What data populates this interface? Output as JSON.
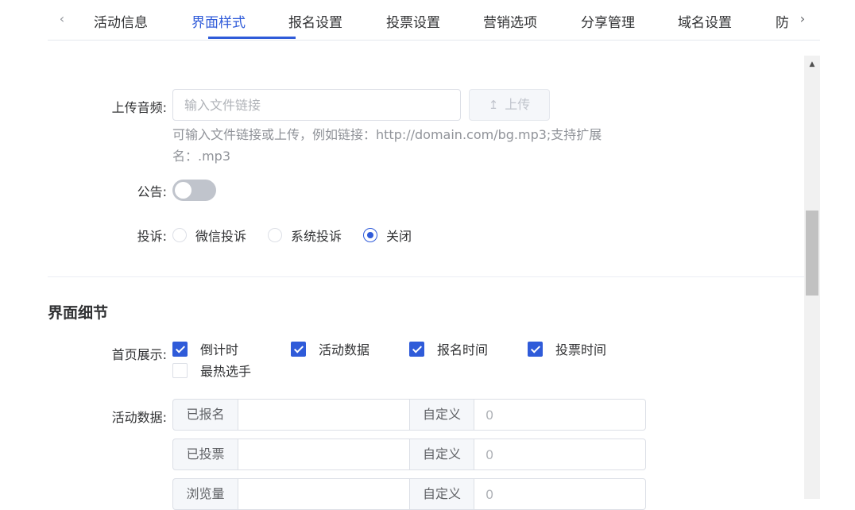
{
  "tabs": {
    "items": [
      "活动信息",
      "界面样式",
      "报名设置",
      "投票设置",
      "营销选项",
      "分享管理",
      "域名设置",
      "防"
    ],
    "active_index": 1
  },
  "audio": {
    "label": "上传音频:",
    "placeholder": "输入文件链接",
    "upload_label": "上传",
    "hint": "可输入文件链接或上传，例如链接：http://domain.com/bg.mp3;支持扩展名：.mp3"
  },
  "notice": {
    "label": "公告:",
    "enabled": false
  },
  "complaint": {
    "label": "投诉:",
    "options": [
      "微信投诉",
      "系统投诉",
      "关闭"
    ],
    "selected_index": 2
  },
  "details": {
    "title": "界面细节",
    "home_display": {
      "label": "首页展示:",
      "options": [
        {
          "label": "倒计时",
          "checked": true
        },
        {
          "label": "活动数据",
          "checked": true
        },
        {
          "label": "报名时间",
          "checked": true
        },
        {
          "label": "投票时间",
          "checked": true
        },
        {
          "label": "最热选手",
          "checked": false
        }
      ]
    },
    "activity_data": {
      "label": "活动数据:",
      "rows": [
        {
          "name": "已报名",
          "value": "",
          "custom_label": "自定义",
          "custom_placeholder": "0"
        },
        {
          "name": "已投票",
          "value": "",
          "custom_label": "自定义",
          "custom_placeholder": "0"
        },
        {
          "name": "浏览量",
          "value": "",
          "custom_label": "自定义",
          "custom_placeholder": "0"
        }
      ]
    }
  },
  "colors": {
    "accent": "#2f5bd9",
    "border": "#dcdfe6",
    "muted": "#909399"
  }
}
